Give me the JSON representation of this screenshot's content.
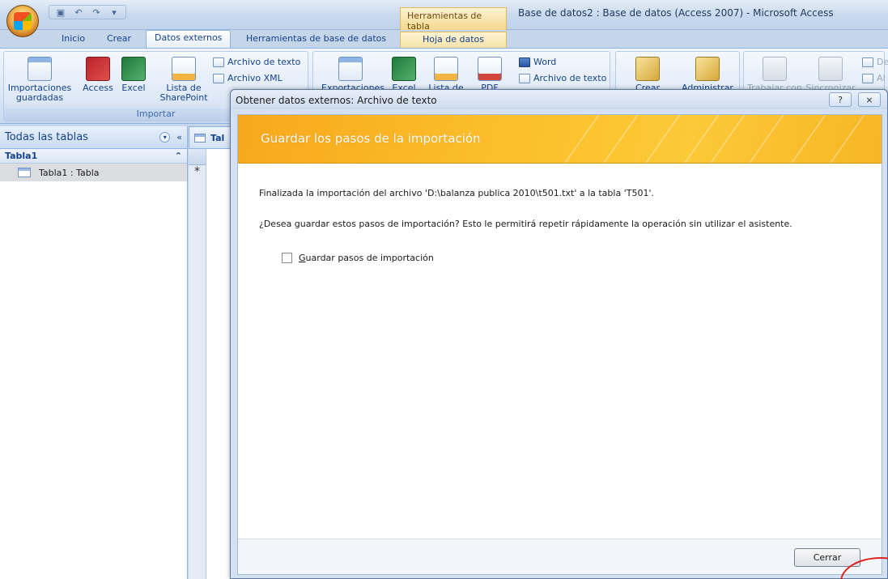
{
  "window": {
    "title": "Base de datos2 : Base de datos (Access 2007) - Microsoft Access",
    "context_tab_group": "Herramientas de tabla"
  },
  "tabs": [
    "Inicio",
    "Crear",
    "Datos externos",
    "Herramientas de base de datos",
    "Hoja de datos"
  ],
  "active_tab": "Datos externos",
  "ribbon": {
    "import_group_label": "Importar",
    "import_saved": "Importaciones guardadas",
    "access": "Access",
    "excel": "Excel",
    "sharepoint": "Lista de SharePoint",
    "text_file": "Archivo de texto",
    "xml_file": "Archivo XML",
    "export_saved": "Exportaciones",
    "exp_excel": "Excel",
    "exp_list": "Lista de",
    "exp_pdf": "PDF",
    "exp_word": "Word",
    "exp_text": "Archivo de texto",
    "create_mail": "Crear correo",
    "manage": "Administrar",
    "offline": "Trabajar con",
    "sync": "Sincronizar",
    "right_1": "De",
    "right_2": "Al"
  },
  "nav": {
    "header": "Todas las tablas",
    "group": "Tabla1",
    "item": "Tabla1 : Tabla"
  },
  "doc": {
    "tab_label": "Tal"
  },
  "dialog": {
    "title": "Obtener datos externos: Archivo de texto",
    "banner": "Guardar los pasos de la importación",
    "message1": "Finalizada la importación del archivo 'D:\\balanza publica 2010\\t501.txt' a la tabla 'T501'.",
    "message2": "¿Desea guardar estos pasos de importación? Esto le permitirá repetir rápidamente la operación sin utilizar el asistente.",
    "checkbox_label": "Guardar pasos de importación",
    "help": "?",
    "close_x": "⨯",
    "close_button": "Cerrar"
  },
  "colors": {
    "banner": "#fbbf2a",
    "ribbon": "#dbe7f6",
    "accent": "#15428b"
  }
}
